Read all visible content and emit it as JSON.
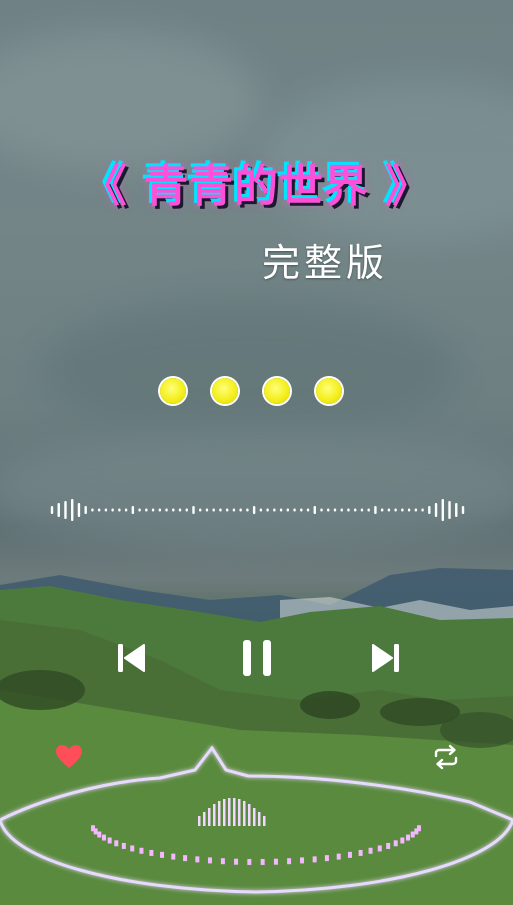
{
  "song": {
    "title": "《 青青的世界 》",
    "subtitle": "完整版"
  },
  "player": {
    "state": "playing",
    "dots_count": 4,
    "liked": true,
    "repeat_mode": "repeat-all"
  },
  "icons": {
    "prev": "skip-previous-icon",
    "pause": "pause-icon",
    "next": "skip-next-icon",
    "like": "heart-icon",
    "repeat": "repeat-icon"
  },
  "colors": {
    "title": "#ff4fd8",
    "title_outline": "#00e5ff",
    "dot": "#f3ef1c",
    "heart": "#ff4d5a",
    "controls": "#ffffff"
  }
}
